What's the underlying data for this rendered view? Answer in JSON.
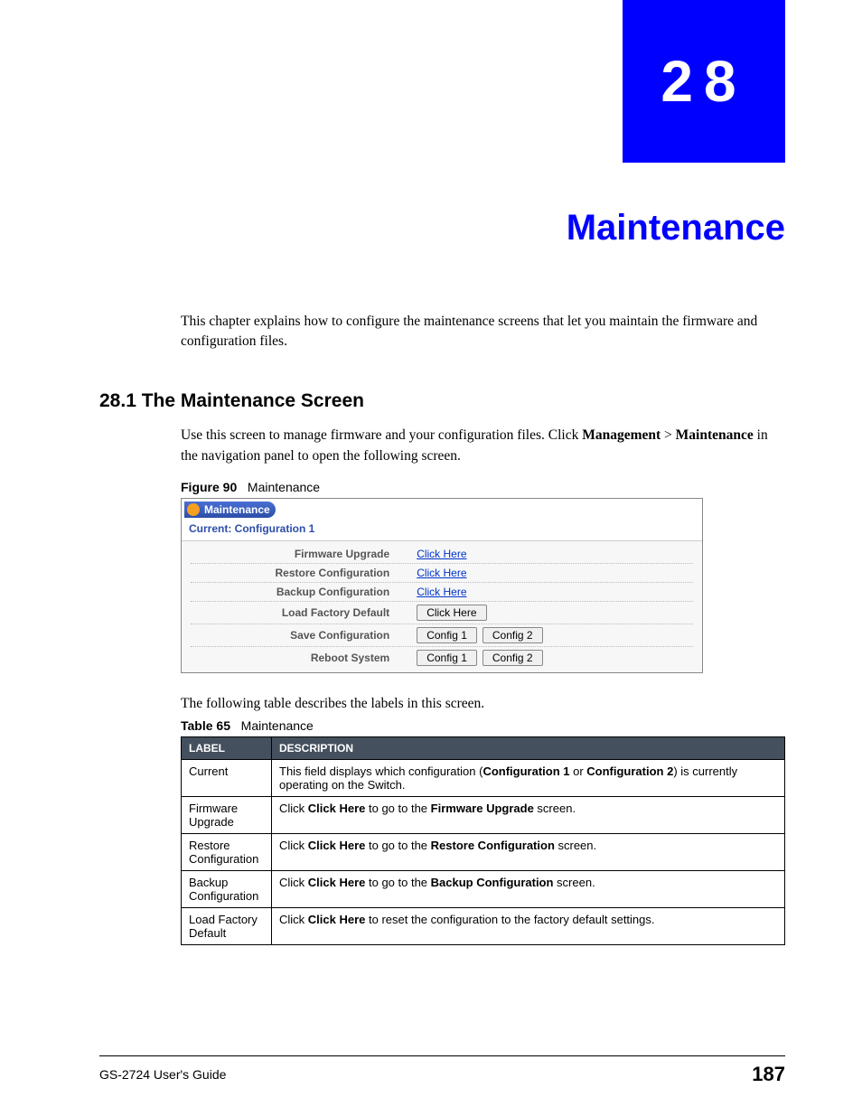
{
  "chapter": {
    "number": "28",
    "title": "Maintenance"
  },
  "intro": "This chapter explains how to configure the maintenance screens that let you maintain the firmware and configuration files.",
  "section": {
    "heading": "28.1  The Maintenance Screen",
    "body_pre": "Use this screen to manage firmware and your configuration files. Click ",
    "body_bold1": "Management",
    "body_mid": " > ",
    "body_bold2": "Maintenance",
    "body_post": " in the navigation panel to open the following screen."
  },
  "figure": {
    "label": "Figure 90",
    "title": "Maintenance",
    "panel_title": "Maintenance",
    "current": "Current: Configuration 1",
    "rows": [
      {
        "label": "Firmware Upgrade",
        "type": "link",
        "action": "Click Here"
      },
      {
        "label": "Restore Configuration",
        "type": "link",
        "action": "Click Here"
      },
      {
        "label": "Backup Configuration",
        "type": "link",
        "action": "Click Here"
      },
      {
        "label": "Load Factory Default",
        "type": "button",
        "actions": [
          "Click Here"
        ]
      },
      {
        "label": "Save Configuration",
        "type": "button",
        "actions": [
          "Config 1",
          "Config 2"
        ]
      },
      {
        "label": "Reboot System",
        "type": "button",
        "actions": [
          "Config 1",
          "Config 2"
        ]
      }
    ]
  },
  "post_figure": "The following table describes the labels in this screen.",
  "table": {
    "label": "Table 65",
    "title": "Maintenance",
    "headers": [
      "LABEL",
      "DESCRIPTION"
    ],
    "rows": [
      {
        "label": "Current",
        "desc_parts": [
          {
            "t": "This field displays which configuration ("
          },
          {
            "t": "Configuration 1",
            "b": true
          },
          {
            "t": " or "
          },
          {
            "t": "Configuration 2",
            "b": true
          },
          {
            "t": ") is currently operating on the Switch."
          }
        ]
      },
      {
        "label": "Firmware Upgrade",
        "desc_parts": [
          {
            "t": "Click "
          },
          {
            "t": "Click Here",
            "b": true
          },
          {
            "t": " to go to the "
          },
          {
            "t": "Firmware Upgrade",
            "b": true
          },
          {
            "t": " screen."
          }
        ]
      },
      {
        "label": "Restore Configuration",
        "desc_parts": [
          {
            "t": "Click "
          },
          {
            "t": "Click Here",
            "b": true
          },
          {
            "t": " to go to the "
          },
          {
            "t": "Restore Configuration",
            "b": true
          },
          {
            "t": " screen."
          }
        ]
      },
      {
        "label": "Backup Configuration",
        "desc_parts": [
          {
            "t": "Click "
          },
          {
            "t": "Click Here",
            "b": true
          },
          {
            "t": " to go to the "
          },
          {
            "t": "Backup Configuration",
            "b": true
          },
          {
            "t": " screen."
          }
        ]
      },
      {
        "label": "Load Factory Default",
        "desc_parts": [
          {
            "t": "Click "
          },
          {
            "t": "Click Here",
            "b": true
          },
          {
            "t": " to reset the configuration to the factory default settings."
          }
        ]
      }
    ]
  },
  "footer": {
    "title": "GS-2724 User's Guide",
    "page": "187"
  }
}
